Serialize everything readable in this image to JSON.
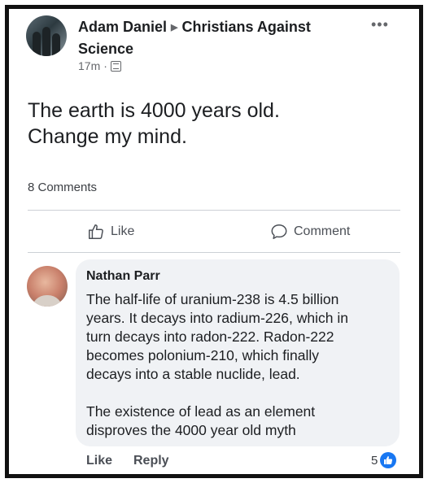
{
  "post": {
    "author": "Adam Daniel",
    "arrow": "▶",
    "group_name_line1": "Christians Against",
    "group_name_line2": "Science",
    "time": "17m",
    "separator": "·",
    "more_icon": "•••",
    "body_line1": "The earth is 4000 years old.",
    "body_line2": "Change my mind.",
    "comments_count": "8 Comments"
  },
  "actions": {
    "like_label": "Like",
    "comment_label": "Comment"
  },
  "comment": {
    "author": "Nathan Parr",
    "lines": [
      "The half-life of uranium-238 is 4.5 billion",
      "years. It decays into radium-226, which in",
      "turn decays into radon-222. Radon-222",
      "becomes polonium-210, which finally",
      "decays into a stable nuclide, lead."
    ],
    "lines2": [
      "The existence of lead as an element",
      "disproves the 4000 year old myth"
    ],
    "like_label": "Like",
    "reply_label": "Reply",
    "reaction_count": "5"
  },
  "icons": {
    "group": "group-icon",
    "more": "more-dots-icon",
    "like": "thumbs-up-icon",
    "comment": "speech-bubble-icon",
    "reaction": "like-reaction-icon"
  },
  "colors": {
    "accent": "#1877f2",
    "text": "#1c1e21",
    "muted": "#65676b",
    "bubble": "#f0f2f5",
    "frame": "#111111"
  }
}
